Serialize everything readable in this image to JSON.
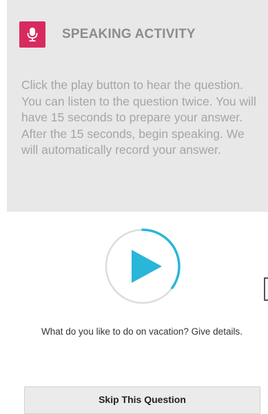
{
  "activity": {
    "title": "SPEAKING ACTIVITY",
    "icon": "microphone-icon",
    "instructions": "Click the play button to hear the question. You can listen to the question twice. You will have 15 seconds to prepare your answer. After the 15 seconds, begin speaking. We will automatically record your answer."
  },
  "player": {
    "icon": "play-icon",
    "listen_progress": 0.35
  },
  "question": {
    "text": "What do you like to do on vacation? Give details."
  },
  "actions": {
    "skip_label": "Skip This Question"
  },
  "colors": {
    "accent": "#d82a5f",
    "play": "#29b6d8",
    "panel_background": "#e8e8e8",
    "ring_track": "#dcdcdc"
  }
}
